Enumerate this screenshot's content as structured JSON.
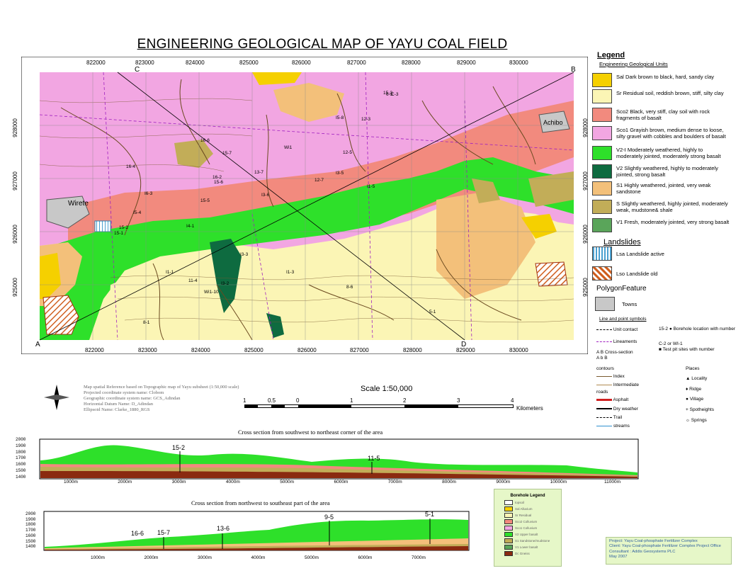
{
  "title": "ENGINEERING GEOLOGICAL MAP OF YAYU COAL FIELD",
  "map": {
    "x_ticks_top": [
      "822000",
      "823000",
      "824000",
      "825000",
      "826000",
      "827000",
      "828000",
      "829000",
      "830000"
    ],
    "x_ticks_bottom": [
      "822000",
      "823000",
      "824000",
      "825000",
      "826000",
      "827000",
      "828000",
      "829000",
      "830000"
    ],
    "y_ticks": [
      "928000",
      "927000",
      "926000",
      "925000"
    ],
    "corner_labels": {
      "c": "C",
      "b": "B",
      "a": "A",
      "d": "D"
    },
    "towns": [
      "Wirete",
      "Achibo"
    ],
    "labels": [
      "15-3",
      "16-6",
      "15-7",
      "I5-8",
      "16-4",
      "16-2",
      "I6-3",
      "15-5",
      "15-6",
      "I5-4",
      "15-2",
      "15-1",
      "I4-1",
      "I3-3",
      "I3-6",
      "13-7",
      "I3-5",
      "12-7",
      "12-3",
      "12-5",
      "I1-5",
      "I1-3",
      "11-4",
      "I1-1",
      "I3-2",
      "Wi1",
      "Wi1-10",
      "5-1",
      "8-1",
      "8-6",
      "6-3",
      "C-3"
    ]
  },
  "legend": {
    "heading": "Legend",
    "sub_heading": "Engineering Geological Units",
    "units": [
      {
        "code": "Sal",
        "text": "Dark brown to black, hard, sandy clay",
        "color": "#f5d000"
      },
      {
        "code": "Sr",
        "text": "Residual soil, reddish brown, stiff, silty clay",
        "color": "#fbf5b5"
      },
      {
        "code": "Sco2",
        "text": "Black, very stiff, clay soil with rock fragments of basalt",
        "color": "#f28a7e"
      },
      {
        "code": "Sco1",
        "text": "Grayish brown, medium dense to loose, silty gravel with cobbles and boulders of basalt",
        "color": "#f2a6e2"
      },
      {
        "code": "V2-I",
        "text": "Moderately weathered, highly to moderately jointed, moderately strong basalt",
        "color": "#2ee02a"
      },
      {
        "code": "V2",
        "text": "Slightly weathered, highly to moderately jointed, strong basalt",
        "color": "#0e6b40"
      },
      {
        "code": "S1",
        "text": "Highly weathered, jointed, very weak sandstone",
        "color": "#f3c07a"
      },
      {
        "code": "S",
        "text": "Slightly weathered, highly jointed, moderately weak, mudstone& shale",
        "color": "#c2ad58"
      },
      {
        "code": "V1",
        "text": "Fresh, moderately jointed, very strong basalt",
        "color": "#5aa55a"
      }
    ],
    "landslides_heading": "Landslides",
    "landslides": [
      {
        "code": "Lsa",
        "text": "Landslide active"
      },
      {
        "code": "Lso",
        "text": "Landslide old"
      }
    ],
    "polygon_heading": "PolygonFeature",
    "towns_label": "Towns",
    "line_heading": "Line and point symbols",
    "unit_contact": "Unit contact",
    "lineaments": "Lineaments",
    "cross_section": "Cross-section",
    "cross_ab": "A B",
    "cross_ab2": "A b B",
    "borehole_code": "15-2",
    "borehole_text": "Borehole location with number",
    "testpit_code": "C-2 or WI-1",
    "testpit_text": "Test pit sites with number",
    "contours_heading": "contours",
    "index": "Index",
    "intermediate": "Intermediate",
    "roads_heading": "roads",
    "asphalt": "Asphalt",
    "dry_weather": "Dry weather",
    "trail": "Trail",
    "streams": "streams",
    "places_heading": "Places",
    "places": [
      "Locality",
      "Ridge",
      "Village",
      "Spotheights",
      "Springs"
    ]
  },
  "metadata_lines": [
    "Map spatial Reference based on Topographic map of Yayu subsheet (1:50,000 scale)",
    "Projected coordinate system name: Clobom",
    "Geographic coordinate system name: GCS_Adindan",
    "Horizontal Datum Name: D_Adindan",
    "Ellipsoid Name: Clarke_1880_RGS"
  ],
  "scale": {
    "label": "Scale  1:50,000",
    "ticks": [
      "1",
      "0.5",
      "0",
      "1",
      "2",
      "3",
      "4"
    ],
    "units": "Kilometers"
  },
  "section1": {
    "title": "Cross section from southwest to northeast corner of the area",
    "y_ticks": [
      "2000",
      "1900",
      "1800",
      "1700",
      "1600",
      "1500",
      "1400"
    ],
    "x_ticks": [
      "1000m",
      "2000m",
      "3000m",
      "4000m",
      "5000m",
      "6000m",
      "7000m",
      "8000m",
      "9000m",
      "10000m",
      "11000m"
    ],
    "boreholes": [
      "15-2",
      "11-5"
    ]
  },
  "section2": {
    "title": "Cross section from northwest to southeast part of the area",
    "y_ticks": [
      "2000",
      "1900",
      "1800",
      "1700",
      "1600",
      "1500",
      "1400"
    ],
    "x_ticks": [
      "1000m",
      "2000m",
      "3000m",
      "4000m",
      "5000m",
      "6000m",
      "7000m"
    ],
    "boreholes": [
      "16-6",
      "15-7",
      "13-6",
      "9-5",
      "5-1"
    ]
  },
  "borehole_legend": {
    "title": "Borehole Legend",
    "items": [
      "topsoil",
      "Sal Alluvium",
      "Sr Residual",
      "Sco2 Colluvium",
      "Sco1 Colluvium",
      "V2 Upper basalt",
      "S1 Sandstone/mudstone",
      "V1 Lower basalt",
      "Dc Gneiss"
    ]
  },
  "project_info": [
    "Project:   Yayu Coal-phosphate Fertilizer Complex",
    "Client:    Yayu Coal-phosphate Fertilizer Complex Project Office",
    "Consultant : Addis Geosystems PLC",
    "May 2007"
  ]
}
